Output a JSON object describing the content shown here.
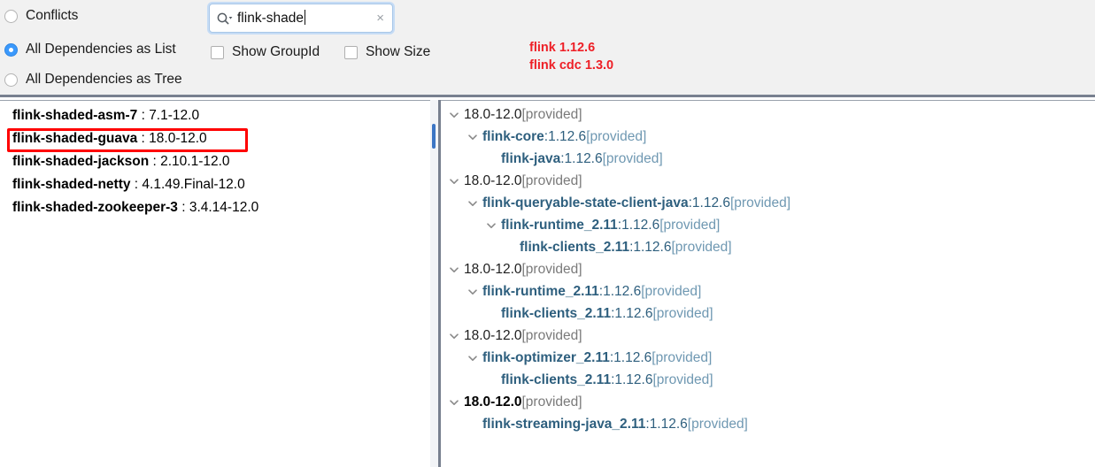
{
  "toolbar": {
    "radios": [
      {
        "label": "Conflicts",
        "checked": false
      },
      {
        "label": "All Dependencies as List",
        "checked": true
      },
      {
        "label": "All Dependencies as Tree",
        "checked": false
      }
    ],
    "checkboxes": [
      {
        "label": "Show GroupId",
        "checked": false
      },
      {
        "label": "Show Size",
        "checked": false
      }
    ],
    "search": {
      "icon": "search-icon",
      "value": "flink-shade",
      "placeholder": "",
      "clear_icon": "×"
    },
    "note": "flink 1.12.6\nflink cdc 1.3.0",
    "note_color": "#ee1f26"
  },
  "left_pane": {
    "items": [
      {
        "name": "flink-shaded-asm-7",
        "sep": " : ",
        "version": "7.1-12.0"
      },
      {
        "name": "flink-shaded-guava",
        "sep": " : ",
        "version": "18.0-12.0"
      },
      {
        "name": "flink-shaded-jackson",
        "sep": " : ",
        "version": "2.10.1-12.0"
      },
      {
        "name": "flink-shaded-netty",
        "sep": " : ",
        "version": "4.1.49.Final-12.0"
      },
      {
        "name": "flink-shaded-zookeeper-3",
        "sep": " : ",
        "version": "3.4.14-12.0"
      }
    ],
    "highlight": {
      "row_index": 1,
      "color": "#ff0000"
    },
    "scrollbar_color": "#3b75c4"
  },
  "right_pane": {
    "nodes": [
      {
        "indent": 0,
        "chevron": "chevron-down-icon",
        "root": true,
        "bold": false,
        "name": "18.0-12.0",
        "sep": "",
        "version": "",
        "scope": " [provided]"
      },
      {
        "indent": 1,
        "chevron": "chevron-down-icon",
        "root": false,
        "bold": false,
        "name": "flink-core",
        "sep": " : ",
        "version": "1.12.6",
        "scope": " [provided]"
      },
      {
        "indent": 2,
        "chevron": "none",
        "root": false,
        "bold": false,
        "name": "flink-java",
        "sep": " : ",
        "version": "1.12.6",
        "scope": " [provided]"
      },
      {
        "indent": 0,
        "chevron": "chevron-down-icon",
        "root": true,
        "bold": false,
        "name": "18.0-12.0",
        "sep": "",
        "version": "",
        "scope": " [provided]"
      },
      {
        "indent": 1,
        "chevron": "chevron-down-icon",
        "root": false,
        "bold": false,
        "name": "flink-queryable-state-client-java",
        "sep": " : ",
        "version": "1.12.6",
        "scope": " [provided]"
      },
      {
        "indent": 2,
        "chevron": "chevron-down-icon",
        "root": false,
        "bold": false,
        "name": "flink-runtime_2.11",
        "sep": " : ",
        "version": "1.12.6",
        "scope": " [provided]"
      },
      {
        "indent": 3,
        "chevron": "none",
        "root": false,
        "bold": false,
        "name": "flink-clients_2.11",
        "sep": " : ",
        "version": "1.12.6",
        "scope": " [provided]"
      },
      {
        "indent": 0,
        "chevron": "chevron-down-icon",
        "root": true,
        "bold": false,
        "name": "18.0-12.0",
        "sep": "",
        "version": "",
        "scope": " [provided]"
      },
      {
        "indent": 1,
        "chevron": "chevron-down-icon",
        "root": false,
        "bold": false,
        "name": "flink-runtime_2.11",
        "sep": " : ",
        "version": "1.12.6",
        "scope": " [provided]"
      },
      {
        "indent": 2,
        "chevron": "none",
        "root": false,
        "bold": false,
        "name": "flink-clients_2.11",
        "sep": " : ",
        "version": "1.12.6",
        "scope": " [provided]"
      },
      {
        "indent": 0,
        "chevron": "chevron-down-icon",
        "root": true,
        "bold": false,
        "name": "18.0-12.0",
        "sep": "",
        "version": "",
        "scope": " [provided]"
      },
      {
        "indent": 1,
        "chevron": "chevron-down-icon",
        "root": false,
        "bold": false,
        "name": "flink-optimizer_2.11",
        "sep": " : ",
        "version": "1.12.6",
        "scope": " [provided]"
      },
      {
        "indent": 2,
        "chevron": "none",
        "root": false,
        "bold": false,
        "name": "flink-clients_2.11",
        "sep": " : ",
        "version": "1.12.6",
        "scope": " [provided]"
      },
      {
        "indent": 0,
        "chevron": "chevron-down-icon",
        "root": true,
        "bold": true,
        "name": "18.0-12.0",
        "sep": "",
        "version": "",
        "scope": " [provided]"
      },
      {
        "indent": 1,
        "chevron": "none",
        "root": false,
        "bold": false,
        "name": "flink-streaming-java_2.11",
        "sep": " : ",
        "version": "1.12.6",
        "scope": " [provided]"
      }
    ]
  }
}
